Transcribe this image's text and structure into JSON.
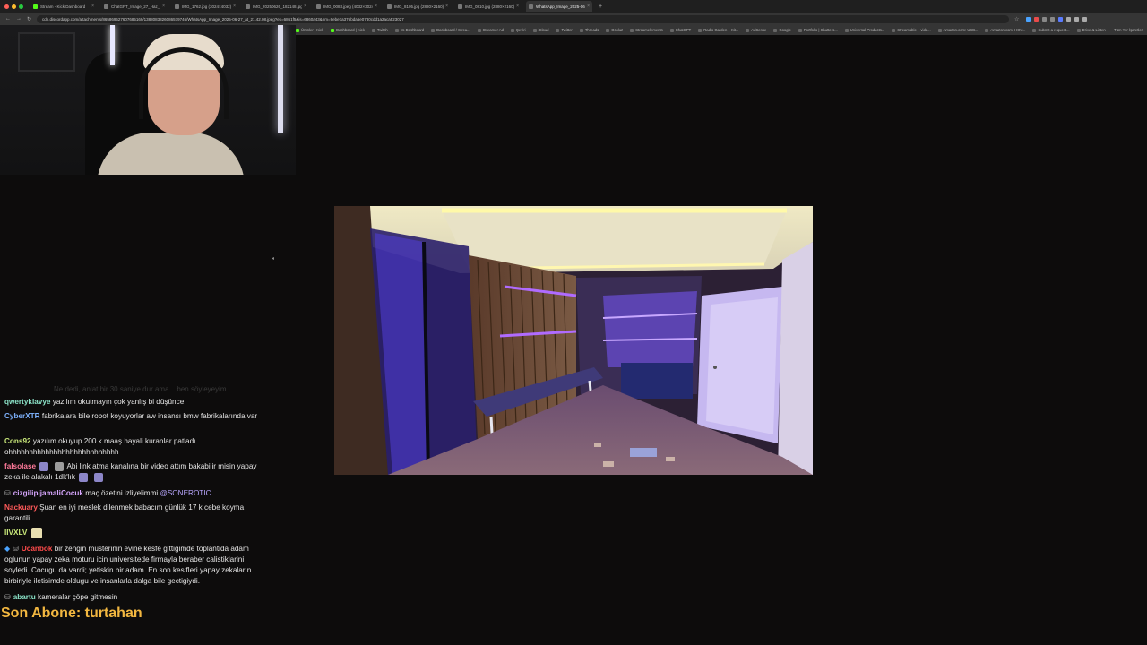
{
  "browser": {
    "tabs": [
      {
        "label": "Stream - Kick Dashboard",
        "icon": "kick-icon",
        "active": false
      },
      {
        "label": "ChatGPT_Image_27_Haz_2025",
        "icon": "image-icon",
        "active": false
      },
      {
        "label": "IMG_1762.jpg (3024×4032)",
        "icon": "image-icon",
        "active": false
      },
      {
        "label": "IMG_20250626_182148.jpg",
        "icon": "image-icon",
        "active": false
      },
      {
        "label": "IMG_0083.jpeg (4032×3024)",
        "icon": "image-icon",
        "active": false
      },
      {
        "label": "IMG_8105.jpg (2880×2160)",
        "icon": "image-icon",
        "active": false
      },
      {
        "label": "IMG_0810.jpg (2880×2160)",
        "icon": "image-icon",
        "active": false
      },
      {
        "label": "WhatsApp_Image_2025-06-...",
        "icon": "image-icon",
        "active": true
      }
    ],
    "new_tab": "+",
    "url": "cdn.discordapp.com/attachments/865869527607685169/1388083826086579746/WhatsApp_Image_2025-06-27_at_21.42.08.jpeg?ex=6861f5&is=6860a43&hm=9ebe7a376bda6e0780cdd1a2aca523027",
    "bookmarks": [
      "Ürünler | Kick",
      "Dashboard | Kick",
      "Twitch",
      "Yo Dashboard",
      "Dashboard / Strea...",
      "Streamer Ad",
      "Çeviri",
      "iCloud",
      "Twitter",
      "Threads",
      "Ocoluz",
      "Streamelements",
      "ChatGPT",
      "Radio Garden – Kit...",
      "AdSense",
      "Google",
      "Portfolio | Shutters...",
      "Universal Products...",
      "Streamable – vide...",
      "Amazon.com: USB...",
      "Amazon.com: HGV...",
      "Submit a request...",
      "Drive & Listen"
    ],
    "bookmarks_right": "Tüm Yer İşaretleri"
  },
  "chat": {
    "faded_line": "Ne dedi, anlat bir 30 saniye dur ama... ben söyleyeyim",
    "messages": [
      {
        "user": "qwertyklavye",
        "color": "#8be3c8",
        "text": "yazılım okutmayın çok yanlış bi düşünce",
        "badges": []
      },
      {
        "user": "CyberXTR",
        "color": "#7eb3ff",
        "text": "fabrikalara bile robot koyuyorlar aw insansı bmw fabrikalarında var",
        "badges": []
      },
      {
        "user": "Cons92",
        "color": "#c9e87a",
        "text": "yazılım okuyup 200 k maaş hayali kuranlar patladı ohhhhhhhhhhhhhhhhhhhhhhhhhhh",
        "badges": []
      },
      {
        "user": "falsolase",
        "color": "#ff7a9a",
        "text": "Abi link atma kanalına bir video attım bakabilir misin yapay zeka ile alakalı 1dk'lık",
        "badges": [
          "emote",
          "emote",
          "emote",
          "emote"
        ]
      },
      {
        "user": "cizgilipijamaliCocuk",
        "color": "#d8a7ff",
        "text": "maç özetini izliyelimmi",
        "mention": "@SONEROTIC",
        "badges": [
          "sub"
        ]
      },
      {
        "user": "Nackuary",
        "color": "#ff5a5a",
        "text": "Şuan en iyi meslek dilenmek babacım günlük 17 k cebe koyma garantili",
        "badges": []
      },
      {
        "user": "IIVXLV",
        "color": "#c9e87a",
        "text": "",
        "badges": [
          "emote"
        ]
      },
      {
        "user": "Ucanbok",
        "color": "#ff4b4b",
        "text": "bir zengin musterinin evine kesfe gittigimde toplantida adam oglunun yapay zeka moturu icin universitede firmayla beraber calistiklarini soyledi. Cocugu da vardi; yetiskin bir adam. En son kesifleri yapay zekaların birbiriyle iletisimde oldugu ve insanlarla dalga bile gectigiydi.",
        "badges": [
          "gift",
          "sub"
        ]
      },
      {
        "user": "abartu",
        "color": "#8be3c8",
        "text": "kameralar çöpe gitmesin",
        "badges": [
          "sub"
        ]
      }
    ]
  },
  "subscriber": {
    "label": "Son Abone: turtahan"
  },
  "colors": {
    "background": "#0d0c0c",
    "sub_banner": "#f2b740",
    "kick_green": "#53fc18"
  }
}
